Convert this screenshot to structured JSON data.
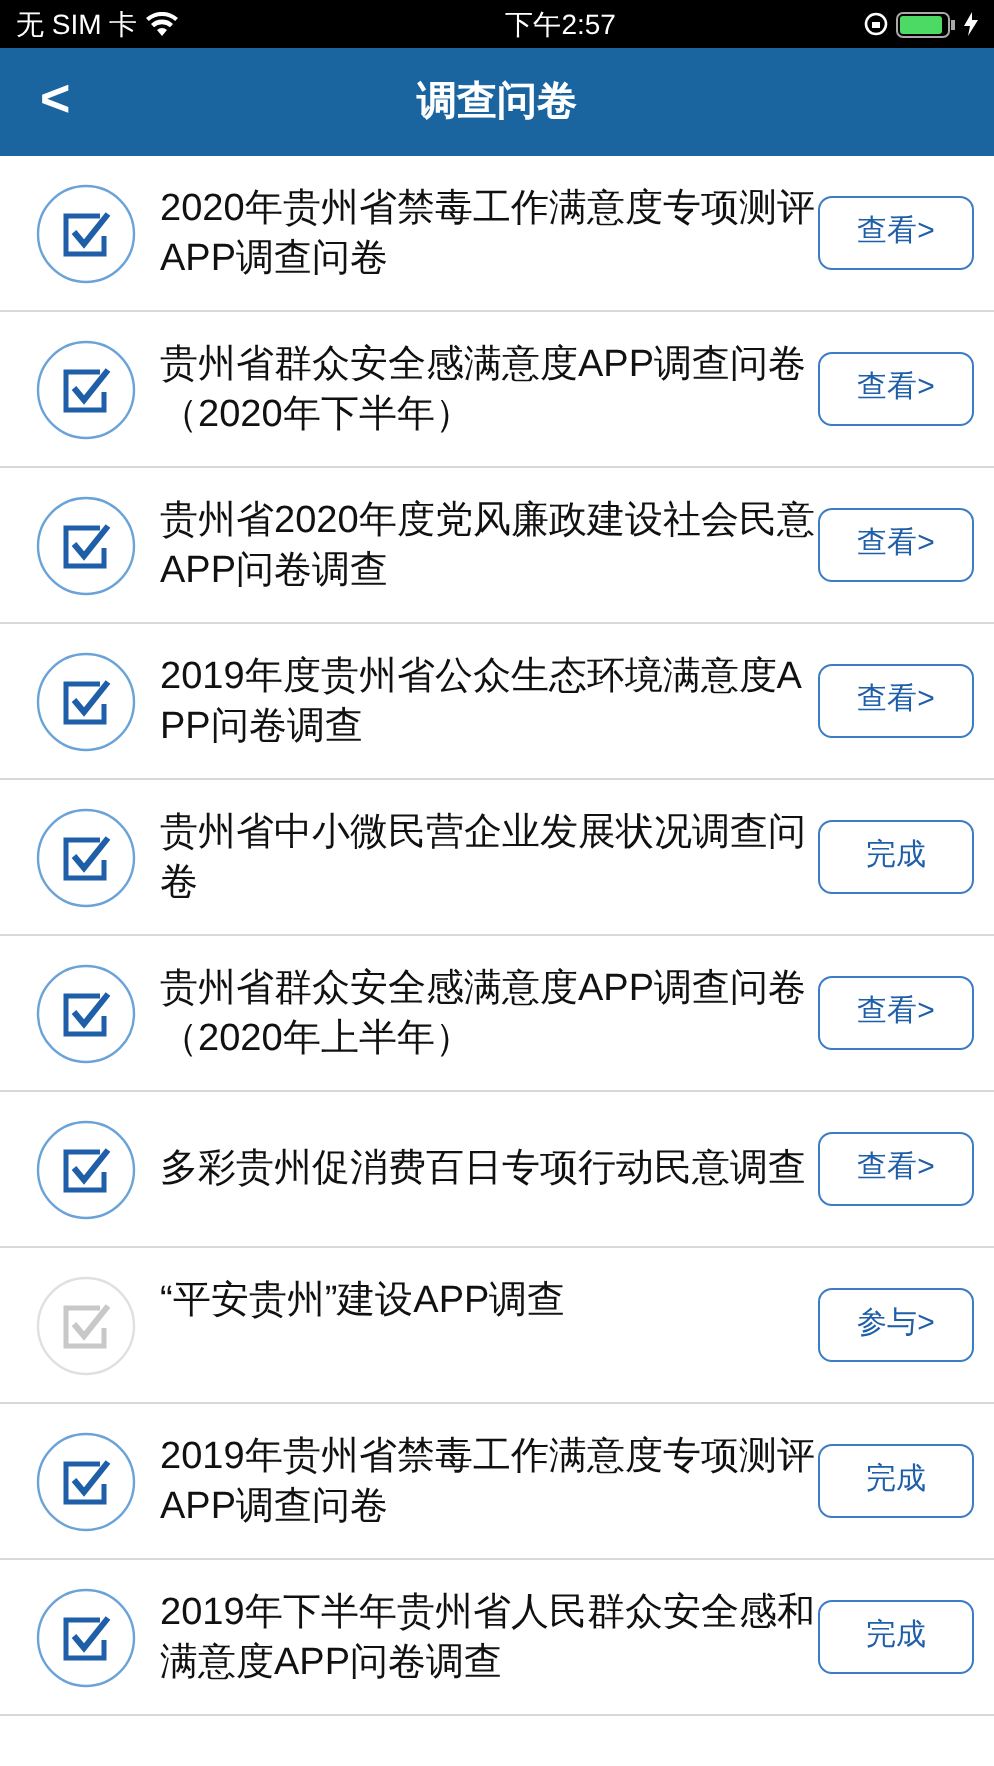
{
  "status_bar": {
    "carrier": "无 SIM 卡",
    "time": "下午2:57"
  },
  "nav": {
    "back": "<",
    "title": "调查问卷"
  },
  "surveys": [
    {
      "title": "2020年贵州省禁毒工作满意度专项测评APP调查问卷",
      "checked": true,
      "action": "查看>"
    },
    {
      "title": "贵州省群众安全感满意度APP调查问卷（2020年下半年）",
      "checked": true,
      "action": "查看>"
    },
    {
      "title": "贵州省2020年度党风廉政建设社会民意APP问卷调查",
      "checked": true,
      "action": "查看>"
    },
    {
      "title": "2019年度贵州省公众生态环境满意度APP问卷调查",
      "checked": true,
      "action": "查看>"
    },
    {
      "title": "贵州省中小微民营企业发展状况调查问卷",
      "checked": true,
      "action": "完成"
    },
    {
      "title": "贵州省群众安全感满意度APP调查问卷（2020年上半年）",
      "checked": true,
      "action": "查看>"
    },
    {
      "title": "多彩贵州促消费百日专项行动民意调查",
      "checked": true,
      "action": "查看>"
    },
    {
      "title": "“平安贵州”建设APP调查",
      "checked": false,
      "action": "参与>"
    },
    {
      "title": "2019年贵州省禁毒工作满意度专项测评APP调查问卷",
      "checked": true,
      "action": "完成"
    },
    {
      "title": "2019年下半年贵州省人民群众安全感和满意度APP问卷调查",
      "checked": true,
      "action": "完成"
    }
  ]
}
